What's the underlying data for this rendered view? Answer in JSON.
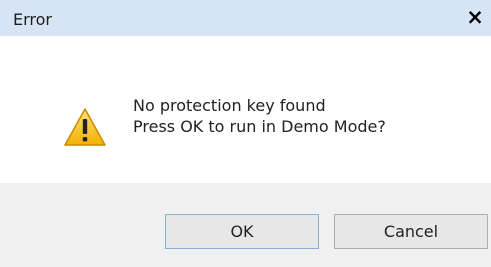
{
  "window": {
    "title": "Error",
    "close_glyph": "×"
  },
  "dialog": {
    "icon": "warning-icon",
    "message_line1": "No protection key found",
    "message_line2": "Press OK to run in Demo Mode?"
  },
  "buttons": {
    "ok_label": "OK",
    "cancel_label": "Cancel"
  },
  "colors": {
    "titlebar": "#d6e4f3",
    "footer": "#f0f0f0",
    "warning_fill": "#f7c829",
    "warning_mark": "#222222"
  }
}
